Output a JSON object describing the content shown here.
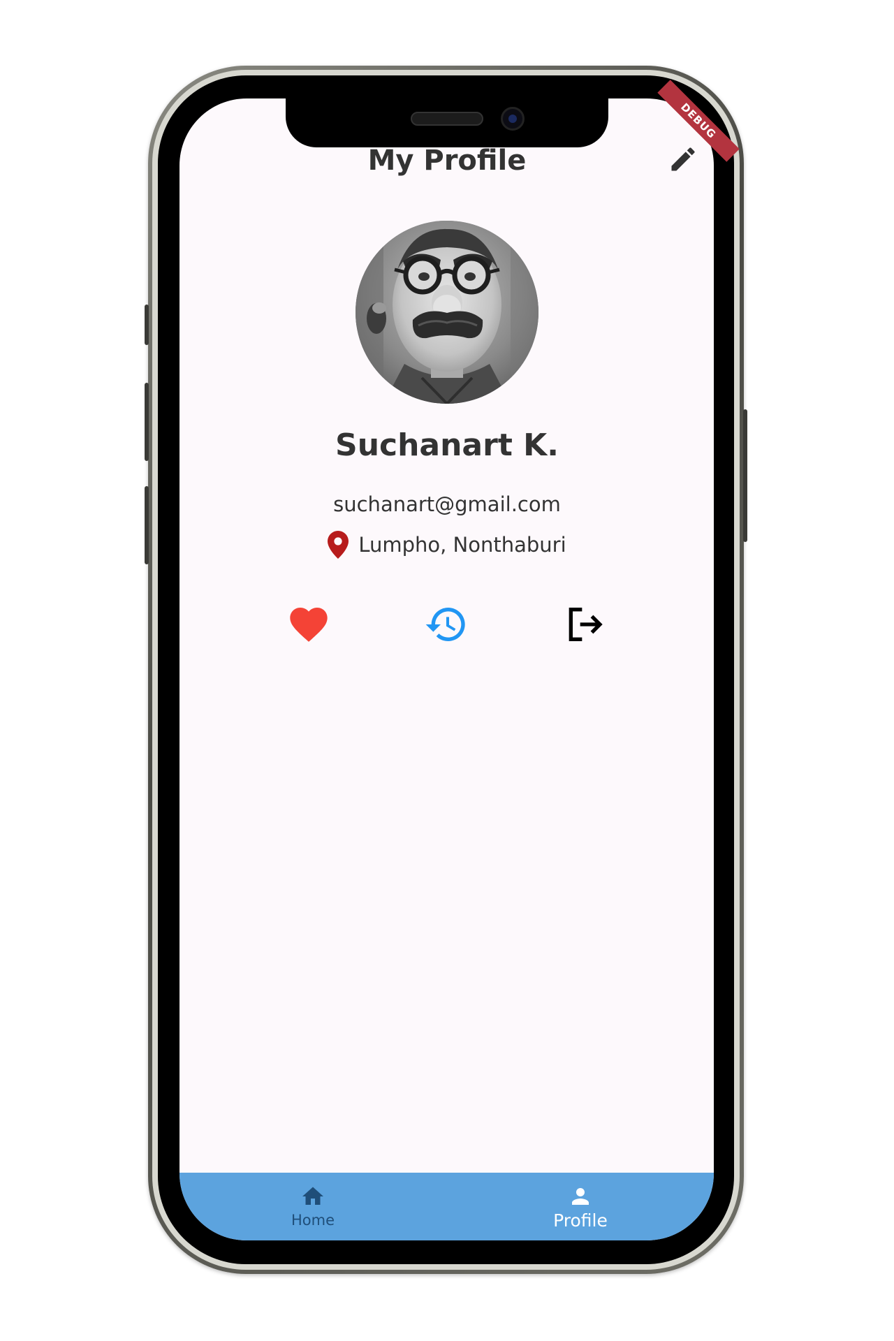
{
  "app": {
    "page_title": "My Profile",
    "debug_banner": "DEBUG"
  },
  "profile": {
    "name": "Suchanart K.",
    "email": "suchanart@gmail.com",
    "location": "Lumpho, Nonthaburi"
  },
  "actions": [
    {
      "icon": "heart-icon",
      "color": "#f44336"
    },
    {
      "icon": "history-icon",
      "color": "#2196f3"
    },
    {
      "icon": "logout-icon",
      "color": "#000000"
    }
  ],
  "bottom_nav": {
    "items": [
      {
        "label": "Home",
        "icon": "home-icon",
        "selected": false
      },
      {
        "label": "Profile",
        "icon": "person-icon",
        "selected": true
      }
    ],
    "background": "#5ca3de",
    "selected_color": "#ffffff",
    "unselected_color": "#1f4e79"
  },
  "colors": {
    "screen_background": "#fdf9fc",
    "text": "#333333",
    "location_pin": "#b71c1c",
    "edit_icon": "#333333"
  }
}
